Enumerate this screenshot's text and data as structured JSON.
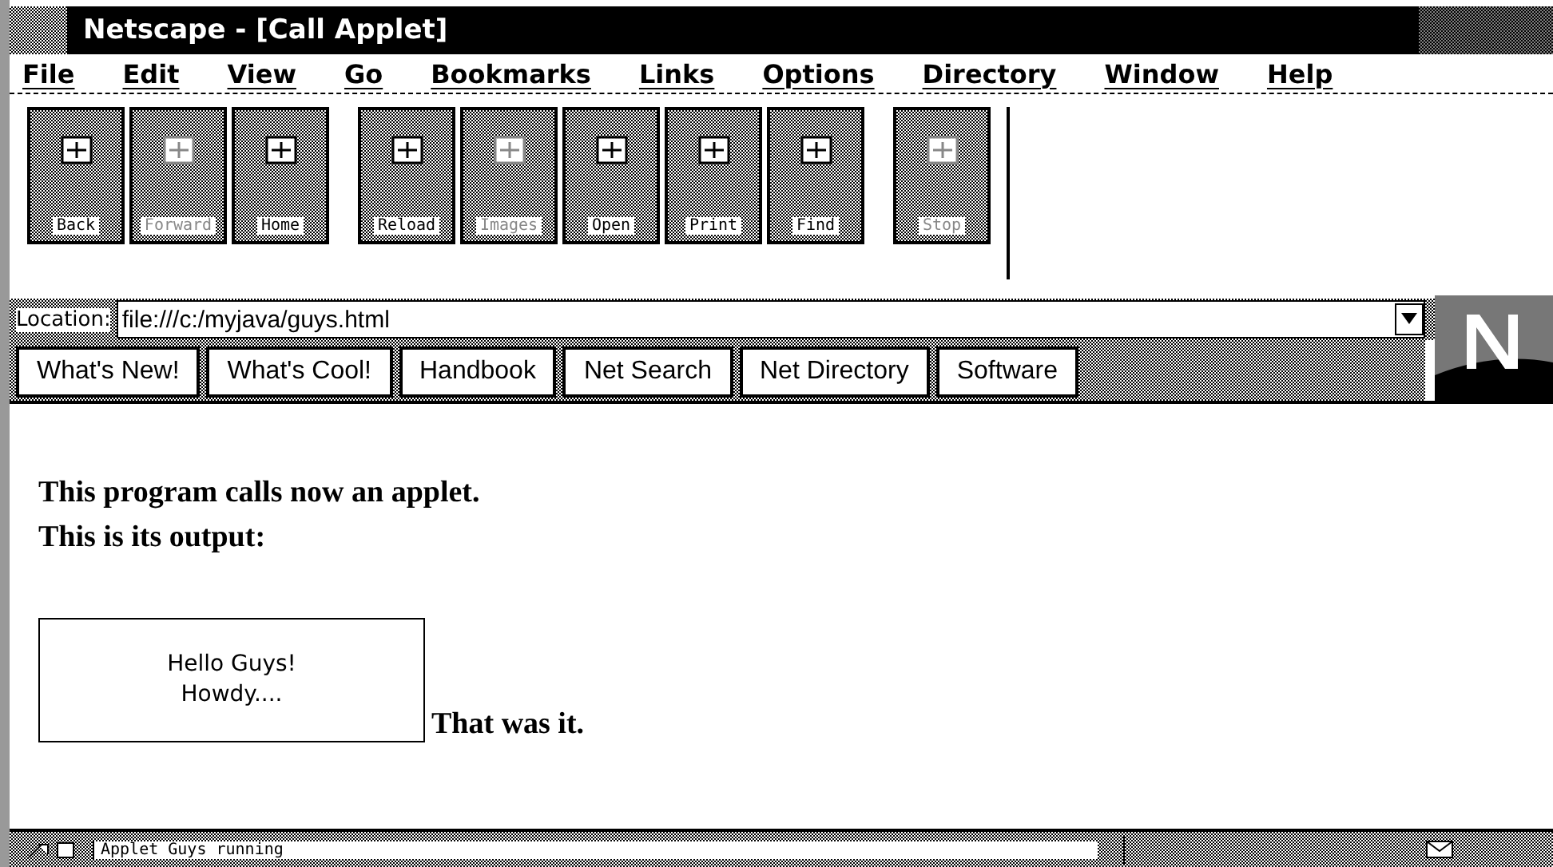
{
  "window": {
    "title": "Netscape - [Call Applet]"
  },
  "menu": [
    "File",
    "Edit",
    "View",
    "Go",
    "Bookmarks",
    "Links",
    "Options",
    "Directory",
    "Window",
    "Help"
  ],
  "toolbar": [
    {
      "buttons": [
        {
          "label": "Back",
          "disabled": false
        },
        {
          "label": "Forward",
          "disabled": true
        },
        {
          "label": "Home",
          "disabled": false
        }
      ]
    },
    {
      "buttons": [
        {
          "label": "Reload",
          "disabled": false
        },
        {
          "label": "Images",
          "disabled": true
        },
        {
          "label": "Open",
          "disabled": false
        },
        {
          "label": "Print",
          "disabled": false
        },
        {
          "label": "Find",
          "disabled": false
        }
      ]
    },
    {
      "buttons": [
        {
          "label": "Stop",
          "disabled": true
        }
      ]
    }
  ],
  "location": {
    "label": "Location:",
    "value": "file:///c:/myjava/guys.html"
  },
  "directory_buttons": [
    "What's New!",
    "What's Cool!",
    "Handbook",
    "Net Search",
    "Net Directory",
    "Software"
  ],
  "content": {
    "lines": [
      "This program calls now an applet.",
      "This is its output:"
    ],
    "applet_lines": [
      "Hello Guys!",
      "Howdy...."
    ],
    "after_applet": "That was it."
  },
  "status_bar": {
    "text": "Applet Guys running"
  }
}
